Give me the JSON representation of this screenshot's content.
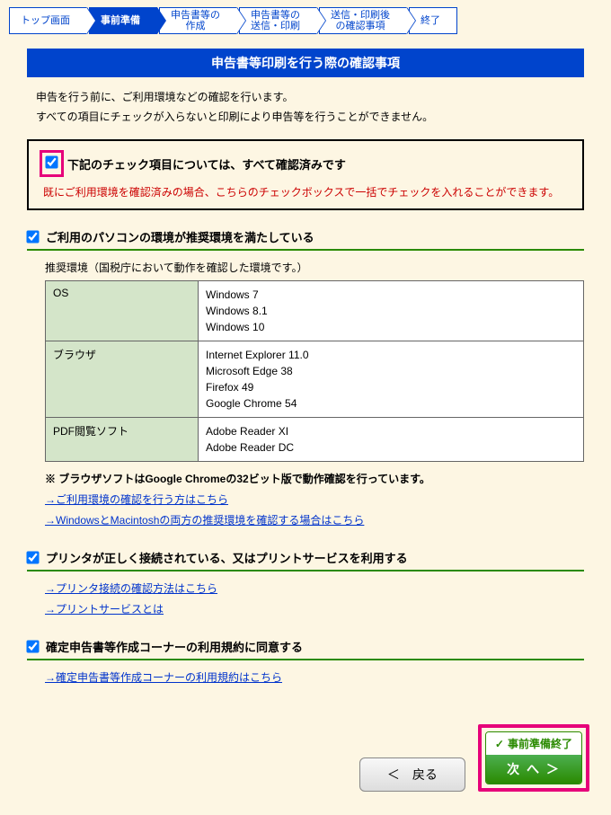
{
  "wizard": {
    "steps": [
      "トップ画面",
      "事前準備",
      "申告書等の\n作成",
      "申告書等の\n送信・印刷",
      "送信・印刷後\nの確認事項",
      "終了"
    ],
    "active": 1
  },
  "title": "申告書等印刷を行う際の確認事項",
  "intro": {
    "line1": "申告を行う前に、ご利用環境などの確認を行います。",
    "line2": "すべての項目にチェックが入らないと印刷により申告等を行うことができません。"
  },
  "allcheck": {
    "title": "下記のチェック項目については、すべて確認済みです",
    "note": "既にご利用環境を確認済みの場合、こちらのチェックボックスで一括でチェックを入れることができます。"
  },
  "section1": {
    "title": "ご利用のパソコンの環境が推奨環境を満たしている",
    "caption": "推奨環境（国税庁において動作を確認した環境です。）",
    "rows": [
      {
        "h": "OS",
        "v": "Windows 7\nWindows 8.1\nWindows 10"
      },
      {
        "h": "ブラウザ",
        "v": "Internet Explorer 11.0\nMicrosoft Edge 38\nFirefox 49\nGoogle Chrome 54"
      },
      {
        "h": "PDF閲覧ソフト",
        "v": "Adobe Reader XI\nAdobe Reader DC"
      }
    ],
    "note": "※ ブラウザソフトはGoogle Chromeの32ビット版で動作確認を行っています。",
    "link1": "→ご利用環境の確認を行う方はこちら",
    "link2": "→WindowsとMacintoshの両方の推奨環境を確認する場合はこちら"
  },
  "section2": {
    "title": "プリンタが正しく接続されている、又はプリントサービスを利用する",
    "link1": "→プリンタ接続の確認方法はこちら",
    "link2": "→プリントサービスとは"
  },
  "section3": {
    "title": "確定申告書等作成コーナーの利用規約に同意する",
    "link1": "→確定申告書等作成コーナーの利用規約はこちら"
  },
  "footer": {
    "back": "＜　戻る",
    "next_label": "事前準備終了",
    "next": "次 へ ＞"
  }
}
